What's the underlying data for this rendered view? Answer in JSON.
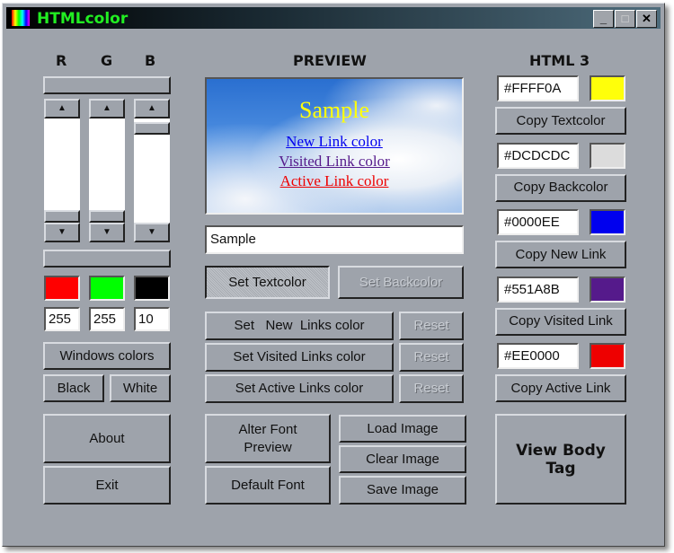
{
  "window": {
    "title": "HTMLcolor",
    "minimize": "_",
    "maximize": "□",
    "close": "✕"
  },
  "rgb": {
    "labels": [
      "R",
      "G",
      "B"
    ],
    "values": [
      "255",
      "255",
      "10"
    ],
    "swatch_colors": [
      "#ff0000",
      "#00ff00",
      "#000000"
    ],
    "slider_fraction": [
      0,
      0,
      0.04
    ],
    "windows_colors": "Windows colors",
    "black": "Black",
    "white": "White",
    "about": "About",
    "exit": "Exit"
  },
  "preview": {
    "heading": "PREVIEW",
    "sample": "Sample",
    "new_link": "New Link color",
    "visited_link": "Visited Link color",
    "active_link": "Active Link color",
    "sample_input": "Sample",
    "set_textcolor": "Set Textcolor",
    "set_backcolor": "Set Backcolor",
    "set_new": "Set   New  Links color",
    "set_visited": "Set Visited Links color",
    "set_active": "Set Active Links color",
    "reset": "Reset",
    "alter_font": "Alter Font Preview",
    "default_font": "Default Font",
    "load_image": "Load Image",
    "clear_image": "Clear Image",
    "save_image": "Save Image"
  },
  "html3": {
    "heading": "HTML 3",
    "rows": [
      {
        "hex": "#FFFF0A",
        "color": "#ffff0a",
        "button": "Copy Textcolor"
      },
      {
        "hex": "#DCDCDC",
        "color": "#dcdcdc",
        "button": "Copy Backcolor"
      },
      {
        "hex": "#0000EE",
        "color": "#0000ee",
        "button": "Copy New Link"
      },
      {
        "hex": "#551A8B",
        "color": "#551a8b",
        "button": "Copy Visited Link"
      },
      {
        "hex": "#EE0000",
        "color": "#ee0000",
        "button": "Copy Active Link"
      }
    ],
    "view_body": "View Body Tag"
  }
}
